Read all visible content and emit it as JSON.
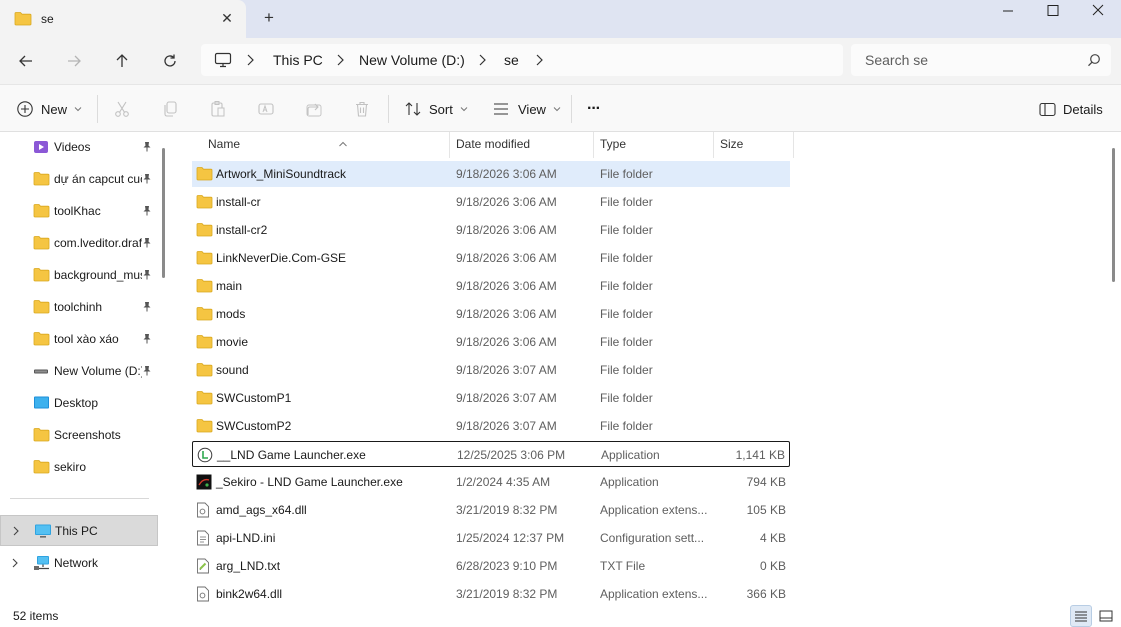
{
  "window": {
    "tab_title": "se",
    "tab_close": "✕",
    "new_tab": "+"
  },
  "address": {
    "crumbs": [
      "This PC",
      "New Volume (D:)",
      "se"
    ],
    "separator": "›"
  },
  "search": {
    "placeholder": "Search se"
  },
  "toolbar": {
    "new_label": "New",
    "sort_label": "Sort",
    "view_label": "View",
    "more_label": "···",
    "details_label": "Details"
  },
  "sidebar": {
    "items": [
      {
        "label": "Videos",
        "icon": "videos-icon",
        "pinned": true
      },
      {
        "label": "dự án capcut cuối",
        "icon": "folder-icon",
        "pinned": true
      },
      {
        "label": "toolKhac",
        "icon": "folder-icon",
        "pinned": true
      },
      {
        "label": "com.lveditor.draft",
        "icon": "folder-icon",
        "pinned": true
      },
      {
        "label": "background_music",
        "icon": "folder-icon",
        "pinned": true
      },
      {
        "label": "toolchinh",
        "icon": "folder-icon",
        "pinned": true
      },
      {
        "label": "tool xào xáo",
        "icon": "folder-icon",
        "pinned": true
      },
      {
        "label": "New Volume (D:)",
        "icon": "drive-icon",
        "pinned": true
      },
      {
        "label": "Desktop",
        "icon": "desktop-icon",
        "pinned": false
      },
      {
        "label": "Screenshots",
        "icon": "folder-icon",
        "pinned": false
      },
      {
        "label": "sekiro",
        "icon": "folder-icon",
        "pinned": false
      }
    ],
    "this_pc": "This PC",
    "network": "Network"
  },
  "columns": {
    "name": "Name",
    "date": "Date modified",
    "type": "Type",
    "size": "Size"
  },
  "files": [
    {
      "name": "Artwork_MiniSoundtrack",
      "date": "9/18/2026 3:06 AM",
      "type": "File folder",
      "size": "",
      "icon": "folder"
    },
    {
      "name": "install-cr",
      "date": "9/18/2026 3:06 AM",
      "type": "File folder",
      "size": "",
      "icon": "folder"
    },
    {
      "name": "install-cr2",
      "date": "9/18/2026 3:06 AM",
      "type": "File folder",
      "size": "",
      "icon": "folder"
    },
    {
      "name": "LinkNeverDie.Com-GSE",
      "date": "9/18/2026 3:06 AM",
      "type": "File folder",
      "size": "",
      "icon": "folder"
    },
    {
      "name": "main",
      "date": "9/18/2026 3:06 AM",
      "type": "File folder",
      "size": "",
      "icon": "folder"
    },
    {
      "name": "mods",
      "date": "9/18/2026 3:06 AM",
      "type": "File folder",
      "size": "",
      "icon": "folder"
    },
    {
      "name": "movie",
      "date": "9/18/2026 3:06 AM",
      "type": "File folder",
      "size": "",
      "icon": "folder"
    },
    {
      "name": "sound",
      "date": "9/18/2026 3:07 AM",
      "type": "File folder",
      "size": "",
      "icon": "folder"
    },
    {
      "name": "SWCustomP1",
      "date": "9/18/2026 3:07 AM",
      "type": "File folder",
      "size": "",
      "icon": "folder"
    },
    {
      "name": "SWCustomP2",
      "date": "9/18/2026 3:07 AM",
      "type": "File folder",
      "size": "",
      "icon": "folder"
    },
    {
      "name": "__LND Game Launcher.exe",
      "date": "12/25/2025 3:06 PM",
      "type": "Application",
      "size": "1,141 KB",
      "icon": "launcher"
    },
    {
      "name": "_Sekiro - LND Game Launcher.exe",
      "date": "1/2/2024 4:35 AM",
      "type": "Application",
      "size": "794 KB",
      "icon": "sekiro"
    },
    {
      "name": "amd_ags_x64.dll",
      "date": "3/21/2019 8:32 PM",
      "type": "Application extens...",
      "size": "105 KB",
      "icon": "dll"
    },
    {
      "name": "api-LND.ini",
      "date": "1/25/2024 12:37 PM",
      "type": "Configuration sett...",
      "size": "4 KB",
      "icon": "ini"
    },
    {
      "name": "arg_LND.txt",
      "date": "6/28/2023 9:10 PM",
      "type": "TXT File",
      "size": "0 KB",
      "icon": "txt"
    },
    {
      "name": "bink2w64.dll",
      "date": "3/21/2019 8:32 PM",
      "type": "Application extens...",
      "size": "366 KB",
      "icon": "dll"
    }
  ],
  "selected_index": 0,
  "focused_index": 10,
  "status": {
    "count": "52 items"
  },
  "colors": {
    "folder": "#f5c542",
    "selection": "#e0ecfb",
    "tabbar": "#dfe4f2"
  }
}
